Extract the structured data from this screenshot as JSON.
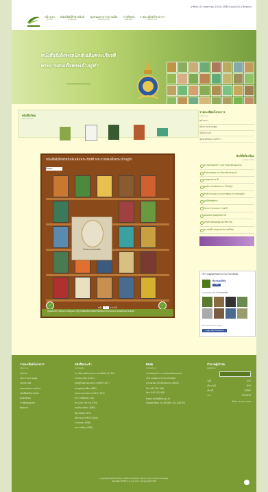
{
  "topbar": {
    "date": "อาทิตย์, 05 พฤษภาคม 2024 | ผู้ใช้งานออนไลน์ | ติดต่อเรา"
  },
  "nav": [
    {
      "th": "หน้าแรก",
      "en": "Home"
    },
    {
      "th": "หนังสืออิเล็กทรอนิกส์",
      "en": "e-Books"
    },
    {
      "th": "ชุมชนและความร่วมมือ",
      "en": "Community"
    },
    {
      "th": "การติดต่อ",
      "en": "Policies"
    },
    {
      "th": "รายละเอียดโครงการ",
      "en": "About us"
    }
  ],
  "banner": {
    "line1": "หนังสืออิเล็กทรอนิกส์เฉลิมพระเกียรติ",
    "line2": "พระบาทสมเด็จพระเจ้าอยู่หัว"
  },
  "new_books": {
    "title": "หนังสือใหม่",
    "subtitle": "new ebooks"
  },
  "shelf": {
    "title": "หนังสืออิเล็กทรอนิกส์เฉลิมพระเกียรติ พระบาทสมเด็จพระเจ้าอยู่หัว",
    "select": "ทั้งหมด",
    "portrait_caption": "ในหลวงของแผ่นดิน",
    "pager_prefix": "หน้า",
    "pager_mid": "จาก",
    "page": "1",
    "total": "50",
    "strip": "ลูกอมสดใส่ ช่วยกันอ่าน เพิ่มพูนความรู้ หนังสืออิเล็กทรอนิกส์ ที่มีเนื้อหาเกี่ยวกับพระบาทสมเด็จพระเจ้าอยู่หัว"
  },
  "sidebar": {
    "about_title": "รายละเอียดโครงการ",
    "about_sub": "about us",
    "about_links": [
      "หน้าแรก",
      "หลักการและเหตุผล",
      "วัตถุประสงค์",
      "ขอบเขตของงานบริการ"
    ],
    "partners_title": "ลิงก์ที่เกี่ยวข้อง",
    "partners_sub": "related links",
    "partners": [
      "สถาบันวิทยบริการ มหาวิทยาลัยขอนแก่น",
      "สำนักหอสมุด มหาวิทยาลัยขอนแก่น",
      "หอสมุดแห่งชาติ",
      "ศูนย์สารสนเทศและการเรียนรู้ฯ",
      "สำนักงานคณะกรรมการพัฒนาการเศรษฐกิจ",
      "มูลนิธิชัยพัฒนา",
      "โครงการตามพระราชดำริ",
      "หอจดหมายเหตุแห่งชาติ",
      "เครือข่ายห้องสมุดมหาวิทยาลัย",
      "สมาคมห้องสมุดแห่งประเทศไทย"
    ],
    "fb_heading": "เข้าร่วมพูดคุยกับพวกเราบน Facebook",
    "fb_page": "ห้องสมุดดิจิทัล",
    "fb_like": "Like",
    "fb_count": "34 people like ห้องสมุดดิจิทัล",
    "fb_plugin": "Facebook social plugin",
    "fb_login": "Login with Facebook"
  },
  "footer": {
    "col1": {
      "title": "รายละเอียดโครงการ",
      "en": "about us",
      "items": [
        "หน้าแรก",
        "หลักการและเหตุผล",
        "วัตถุประสงค์",
        "ขอบเขตของงานบริการ",
        "หนังสืออิเล็กทรอนิกส์",
        "ชุมชนสังคม",
        "การพิมพ์เผยแพร่",
        "ติดต่อเรา"
      ]
    },
    "col2": {
      "title": "หนังสือแนะนำ",
      "en": "top books",
      "items": [
        "ประวัติศาสตร์และพระราชกรณียกิจ (1150)",
        "ทรงพระเจริญ (1121)",
        "ทฤษฎีใหม่ตามแนวพระราชดำริ (917)",
        "เศรษฐกิจพอเพียง (863)",
        "โครงการตามพระราชดำริ (750)",
        "พระราชนิพนธ์ (712)",
        "พระบรมราโชวาท (703)",
        "ดนตรีและศิลปะ (685)",
        "สิ่งแวดล้อม (671)",
        "กีฬาและการเรือใบ (645)",
        "การเกษตร (598)",
        "พระราชนิยม (566)"
      ]
    },
    "col3": {
      "title": "ติดต่อ",
      "en": "contact us",
      "lines": [
        "สำนักวิทยบริการ มหาวิทยาลัยขอนแก่น",
        "123 ถนนมิตรภาพ ตำบลในเมือง",
        "อำเภอเมือง จังหวัดขอนแก่น 40002",
        "Tel: 043 202 466",
        "Fax: 043 202 469"
      ],
      "email": "Email: kklib@kku.ac.th",
      "map": "Google Map: 16.447889,102.826750"
    },
    "col4": {
      "title": "จำนวนผู้เข้าชม",
      "en": "statistics",
      "stats": [
        {
          "label": "วันนี้",
          "value": "547"
        },
        {
          "label": "เมื่อวานนี้",
          "value": "619"
        },
        {
          "label": "เดือนนี้",
          "value": "12880"
        },
        {
          "label": "รวม",
          "value": "1550376"
        }
      ],
      "since": "ตั้งแต่ 15 พ.ค. 2555"
    },
    "copyright_1": "Copyright@2016 Office of KKU University Library, Khon Kaen University",
    "copyright_2": "Validated HTML 5.0 and CSS 3 Copyright 2016"
  }
}
